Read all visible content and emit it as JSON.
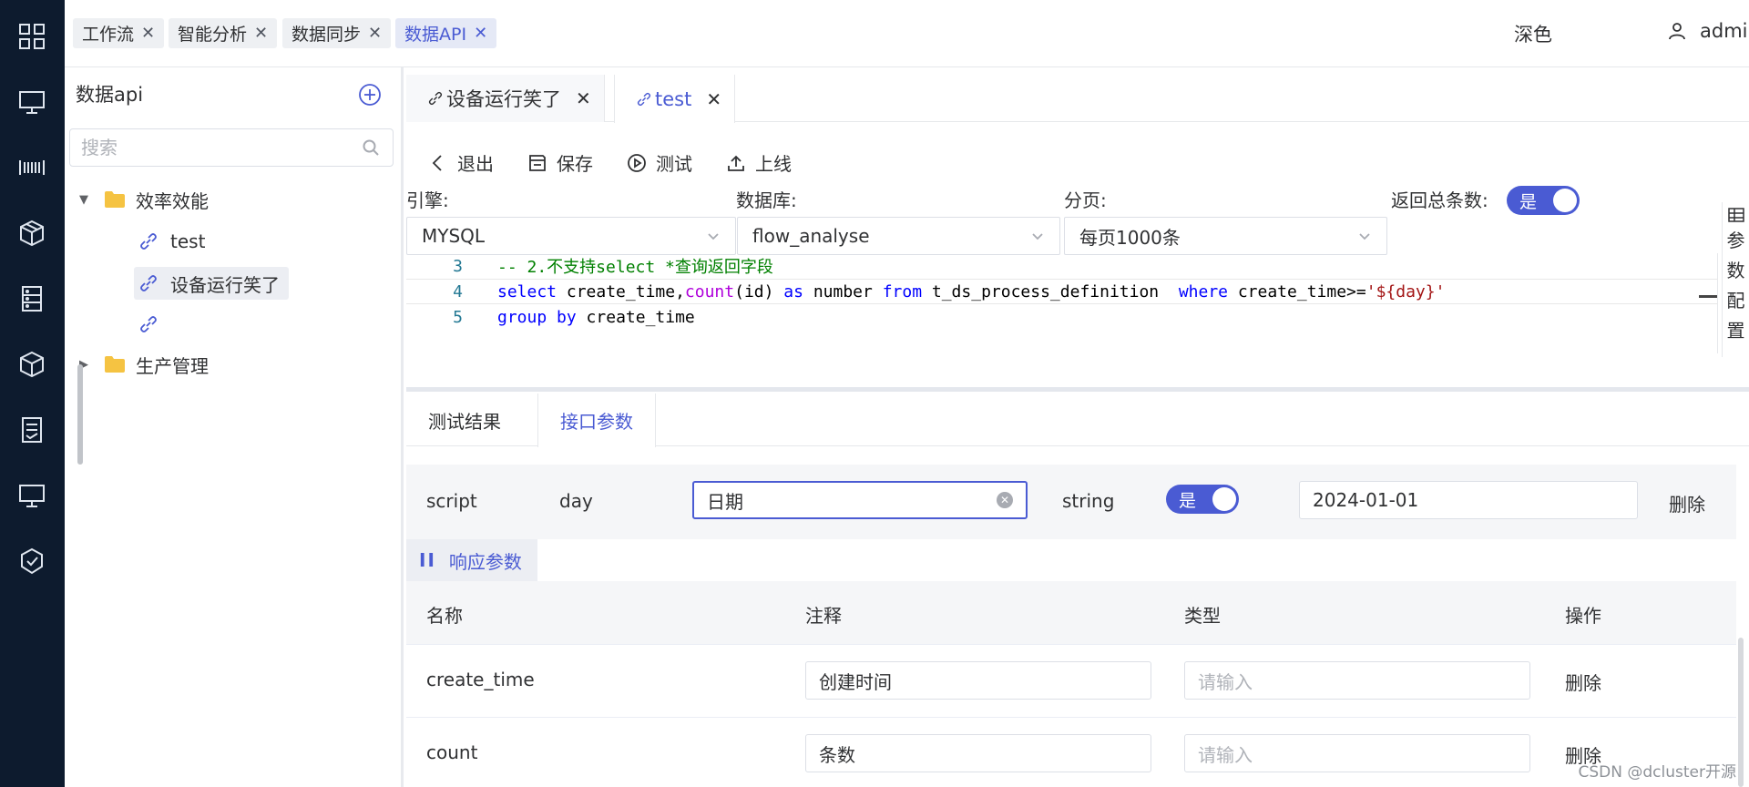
{
  "topbar": {
    "tabs": [
      {
        "label": "工作流"
      },
      {
        "label": "智能分析"
      },
      {
        "label": "数据同步"
      },
      {
        "label": "数据API"
      }
    ],
    "theme_label": "深色",
    "user_name": "admin"
  },
  "tree": {
    "title": "数据api",
    "search_placeholder": "搜索",
    "folder1": "效率效能",
    "item_test": "test",
    "item_device": "设备运行笑了",
    "item_empty": "",
    "folder2": "生产管理"
  },
  "editor_tabs": [
    {
      "label": "设备运行笑了"
    },
    {
      "label": "test"
    }
  ],
  "toolbar": {
    "exit": "退出",
    "save": "保存",
    "test": "测试",
    "publish": "上线"
  },
  "config": {
    "engine_label": "引擎:",
    "engine_value": "MYSQL",
    "db_label": "数据库:",
    "db_value": "flow_analyse",
    "page_label": "分页:",
    "page_value": "每页1000条",
    "total_label": "返回总条数:",
    "total_switch": "是"
  },
  "side_tab": {
    "label_1": "参",
    "label_2": "数",
    "label_3": "配",
    "label_4": "置"
  },
  "code": {
    "lines": [
      {
        "no": "3"
      },
      {
        "no": "4"
      },
      {
        "no": "5"
      }
    ],
    "line3_comment": "-- 2.不支持select *查询返回字段",
    "l4_select": "select",
    "l4_col": " create_time,",
    "l4_count": "count",
    "l4_args": "(id) ",
    "l4_as": "as",
    "l4_alias": " number ",
    "l4_from": "from",
    "l4_table": " t_ds_process_definition  ",
    "l4_where": "where",
    "l4_cond": " create_time",
    "l4_op": ">=",
    "l4_str": "'${day}'",
    "l5_group": "group",
    "l5_by": "by",
    "l5_col": " create_time"
  },
  "bottom_tabs": {
    "result": "测试结果",
    "params": "接口参数"
  },
  "param": {
    "type": "script",
    "name": "day",
    "comment": "日期",
    "data_type": "string",
    "switch": "是",
    "default_value": "2024-01-01",
    "delete": "删除"
  },
  "response_tab": "响应参数",
  "table": {
    "headers": {
      "name": "名称",
      "comment": "注释",
      "type": "类型",
      "action": "操作"
    },
    "rows": [
      {
        "name": "create_time",
        "comment": "创建时间",
        "type_placeholder": "请输入",
        "action": "删除"
      },
      {
        "name": "count",
        "comment": "条数",
        "type_placeholder": "请输入",
        "action": "删除"
      }
    ]
  },
  "watermark": "CSDN @dcluster开源"
}
